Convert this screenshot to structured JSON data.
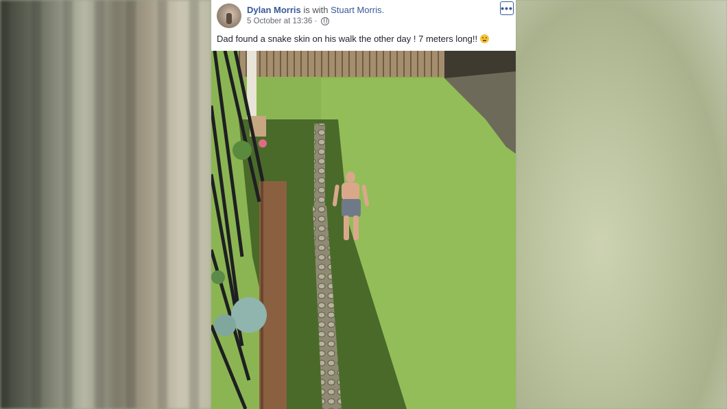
{
  "post": {
    "author": "Dylan Morris",
    "with_text": "is with",
    "tagged": "Stuart Morris.",
    "timestamp": "5 October at 13:36 ·",
    "privacy_icon": "globe-icon",
    "text": "Dad found a snake skin on his walk the other day ! 7 meters long!!",
    "emoji": "flushed-face-emoji",
    "more_icon": "more-options-icon",
    "more_label": "•••"
  }
}
